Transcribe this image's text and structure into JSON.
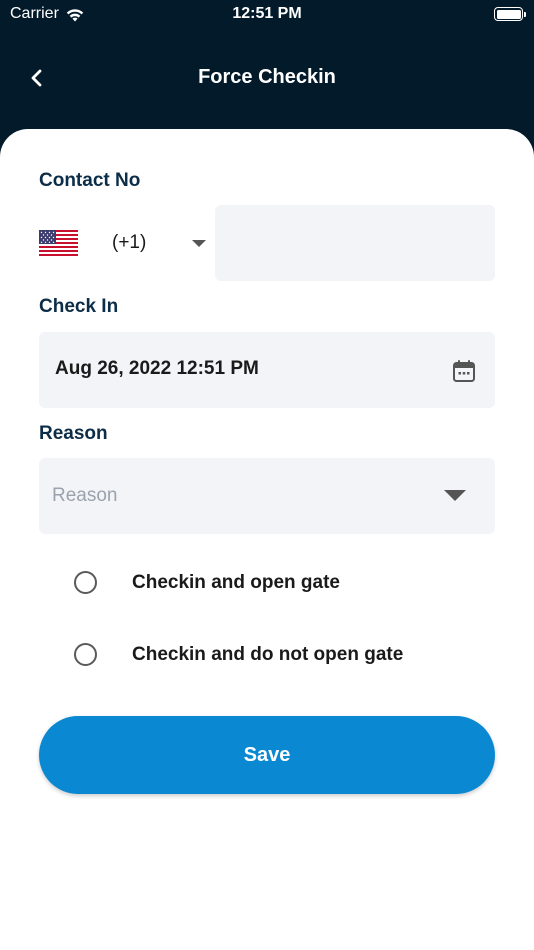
{
  "status_bar": {
    "carrier": "Carrier",
    "time": "12:51 PM",
    "wifi_icon": "wifi-icon",
    "battery_icon": "battery-icon"
  },
  "nav": {
    "title": "Force Checkin",
    "back_icon": "chevron-left-icon"
  },
  "form": {
    "contact": {
      "label": "Contact No",
      "country_flag": "us-flag-icon",
      "country_code": "(+1)",
      "phone_value": "",
      "phone_placeholder": ""
    },
    "check_in": {
      "label": "Check In",
      "value": "Aug 26, 2022 12:51 PM",
      "icon": "calendar-icon"
    },
    "reason": {
      "label": "Reason",
      "placeholder": "Reason",
      "icon": "caret-down-icon"
    },
    "options": [
      {
        "label": "Checkin and open gate",
        "selected": false
      },
      {
        "label": "Checkin and do not open gate",
        "selected": false
      }
    ],
    "save_label": "Save"
  },
  "colors": {
    "header_bg": "#031a2a",
    "label_color": "#0c2d48",
    "field_bg": "#f3f4f7",
    "accent": "#0a88d2"
  }
}
